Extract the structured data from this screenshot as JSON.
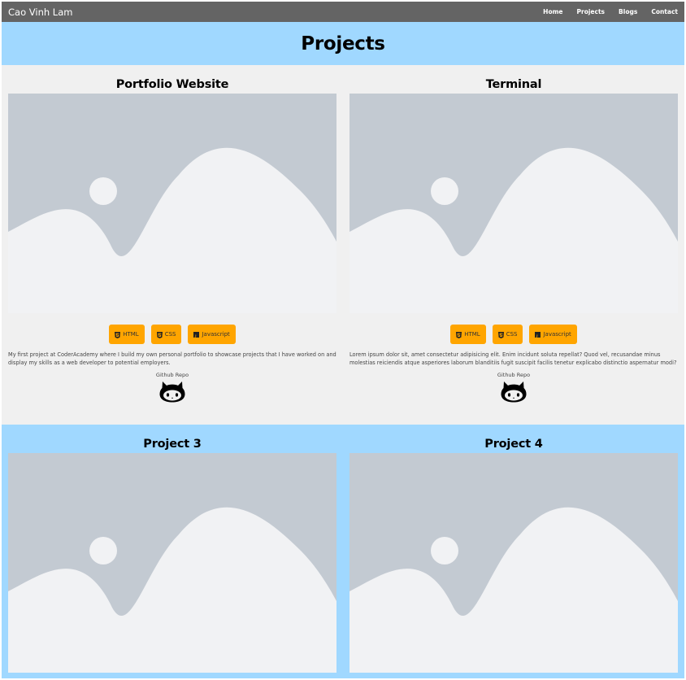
{
  "nav": {
    "brand": "Cao Vinh Lam",
    "links": [
      "Home",
      "Projects",
      "Blogs",
      "Contact"
    ]
  },
  "header": {
    "title": "Projects"
  },
  "projects": [
    {
      "title": "Portfolio Website",
      "tech": [
        "HTML",
        "CSS",
        "Javascript"
      ],
      "description": "My first project at CoderAcademy where I build my own personal portfolio to showcase projects that I have worked on and display my skills as a web developer to potential employers.",
      "repo_label": "Github Repo"
    },
    {
      "title": "Terminal",
      "tech": [
        "HTML",
        "CSS",
        "Javascript"
      ],
      "description": "Lorem ipsum dolor sit, amet consectetur adipisicing elit. Enim incidunt soluta repellat? Quod vel, recusandae minus molestias reiciendis atque asperiores laborum blanditiis fugit suscipit facilis tenetur explicabo distinctio aspernatur modi?",
      "repo_label": "Github Repo"
    },
    {
      "title": "Project 3"
    },
    {
      "title": "Project 4"
    }
  ],
  "icons": {
    "tech": [
      "html5-icon",
      "css3-icon",
      "javascript-icon"
    ],
    "repo": "github-octocat-icon",
    "placeholder": "image-placeholder-icon"
  },
  "colors": {
    "navbar": "#646464",
    "header_band": "#a0d8ff",
    "badge": "#ffa500",
    "placeholder_bg": "#c3cad2",
    "placeholder_fg": "#f1f2f4"
  }
}
